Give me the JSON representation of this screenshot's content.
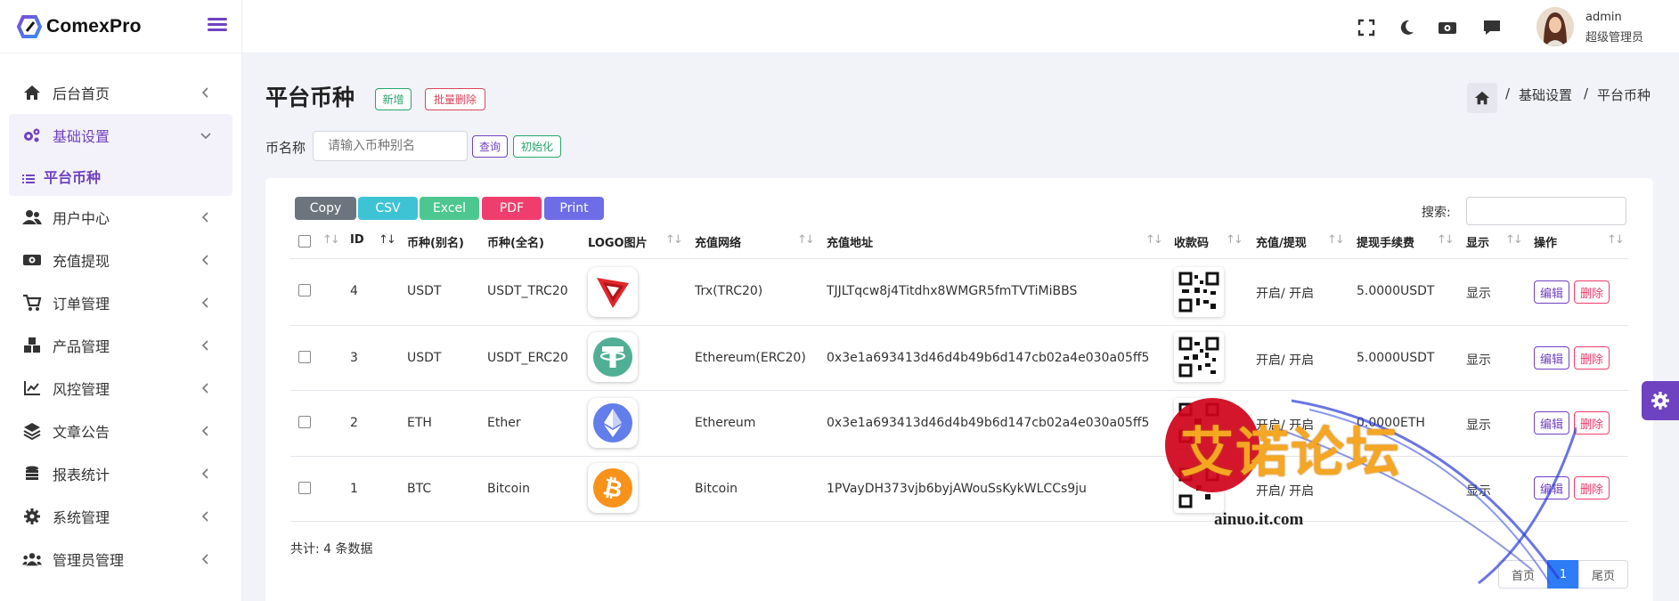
{
  "app": {
    "name": "ComexPro"
  },
  "sidebar": {
    "items": [
      {
        "label": "后台首页"
      },
      {
        "label": "基础设置"
      },
      {
        "label": "用户中心"
      },
      {
        "label": "充值提现"
      },
      {
        "label": "订单管理"
      },
      {
        "label": "产品管理"
      },
      {
        "label": "风控管理"
      },
      {
        "label": "文章公告"
      },
      {
        "label": "报表统计"
      },
      {
        "label": "系统管理"
      },
      {
        "label": "管理员管理"
      }
    ],
    "sub_active": "平台币种"
  },
  "topbar": {
    "username": "admin",
    "role": "超级管理员"
  },
  "page": {
    "title": "平台币种",
    "add_label": "新增",
    "batch_delete_label": "批量删除",
    "breadcrumb": [
      "基础设置",
      "平台币种"
    ],
    "breadcrumb_sep": "/"
  },
  "filter": {
    "label": "币名称",
    "placeholder": "请输入币种别名",
    "query_label": "查询",
    "init_label": "初始化"
  },
  "toolbar": {
    "buttons": [
      "Copy",
      "CSV",
      "Excel",
      "PDF",
      "Print"
    ],
    "search_label": "搜索:"
  },
  "table": {
    "headers": [
      "ID",
      "币种(别名)",
      "币种(全名)",
      "LOGO图片",
      "充值网络",
      "充值地址",
      "收款码",
      "充值/提现",
      "提现手续费",
      "显示",
      "操作"
    ],
    "rows": [
      {
        "id": "4",
        "alias": "USDT",
        "full": "USDT_TRC20",
        "logo": "tron-logo-icon",
        "network": "Trx(TRC20)",
        "address": "TJJLTqcw8j4Titdhx8WMGR5fmTVTiMiBBS",
        "status": "开启/ 开启",
        "fee": "5.0000USDT",
        "show": "显示"
      },
      {
        "id": "3",
        "alias": "USDT",
        "full": "USDT_ERC20",
        "logo": "tether-logo-icon",
        "network": "Ethereum(ERC20)",
        "address": "0x3e1a693413d46d4b49b6d147cb02a4e030a05ff5",
        "status": "开启/ 开启",
        "fee": "5.0000USDT",
        "show": "显示"
      },
      {
        "id": "2",
        "alias": "ETH",
        "full": "Ether",
        "logo": "ethereum-logo-icon",
        "network": "Ethereum",
        "address": "0x3e1a693413d46d4b49b6d147cb02a4e030a05ff5",
        "status": "开启/ 开启",
        "fee": "0.0000ETH",
        "show": "显示"
      },
      {
        "id": "1",
        "alias": "BTC",
        "full": "Bitcoin",
        "logo": "bitcoin-logo-icon",
        "network": "Bitcoin",
        "address": "1PVayDH373vjb6byjAWouSsKykWLCCs9ju",
        "status": "开启/ 开启",
        "fee": "",
        "show": "显示"
      }
    ],
    "edit_label": "编辑",
    "delete_label": "删除"
  },
  "footer": {
    "total": "共计: 4 条数据",
    "first": "首页",
    "page": "1",
    "last": "尾页"
  },
  "watermark": {
    "text": "艾诺论坛",
    "url": "ainuo.it.com"
  },
  "colors": {
    "accent": "#6f42c1",
    "copy": "#6c757d",
    "csv": "#3ec3d5",
    "excel": "#4cc790",
    "pdf": "#ef3e6d",
    "print": "#6f6ce8",
    "edit": "#6f42c1",
    "delete": "#ef3e6d",
    "page_active": "#2e7cf6"
  }
}
